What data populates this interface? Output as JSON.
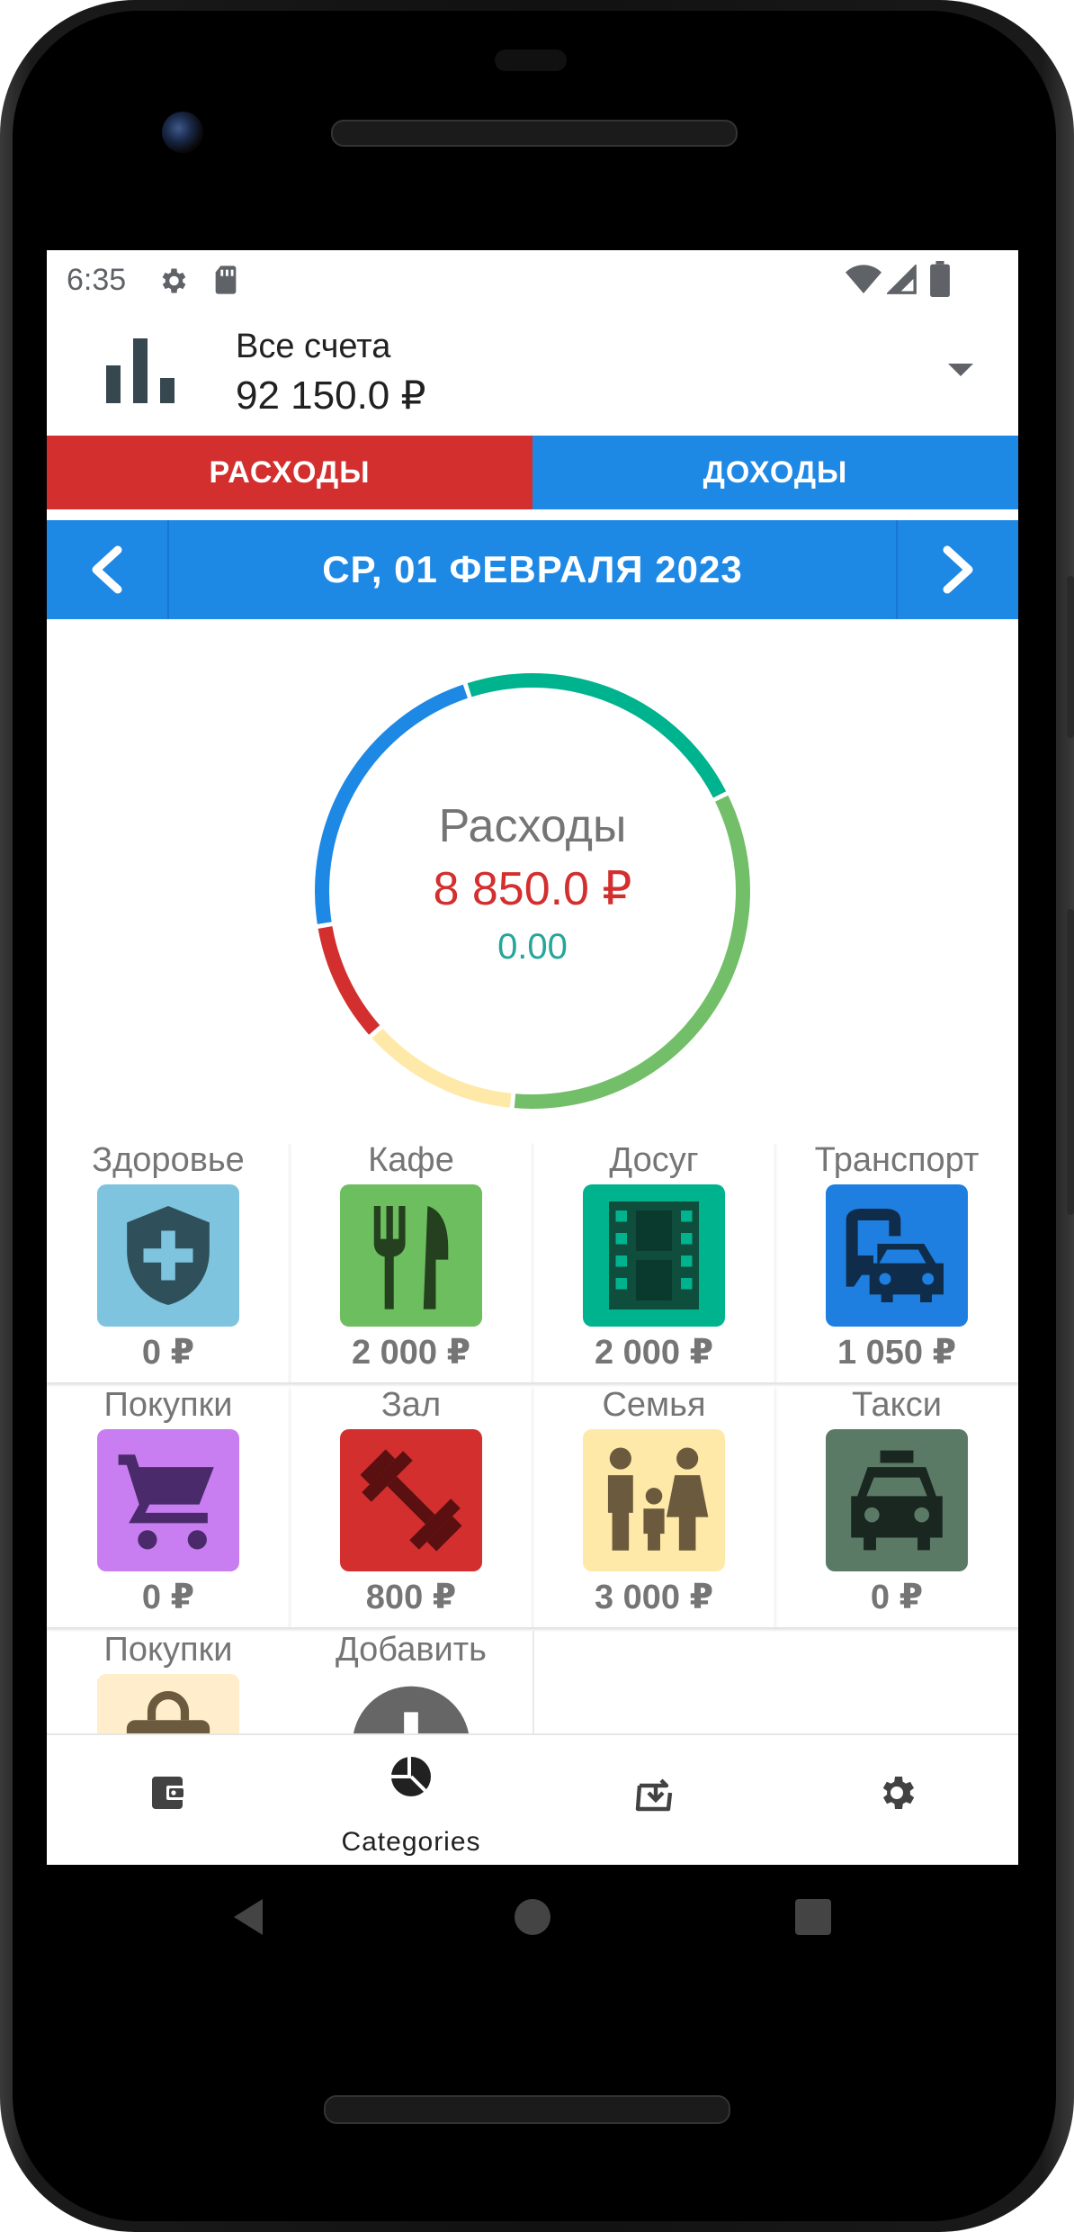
{
  "status_bar": {
    "time": "6:35"
  },
  "account": {
    "name": "Все счета",
    "balance": "92 150.0 ₽"
  },
  "tabs": {
    "expense": "РАСХОДЫ",
    "income": "ДОХОДЫ"
  },
  "date_nav": {
    "date": "СР, 01 ФЕВРАЛЯ 2023"
  },
  "summary": {
    "title": "Расходы",
    "amount": "8 850.0 ₽",
    "sub": "0.00"
  },
  "donut_segments": [
    {
      "category": "Досуг",
      "value": 2000,
      "color": "#00b38f"
    },
    {
      "category": "Семья",
      "value": 3000,
      "color": "#73bf69"
    },
    {
      "category": "Транспорт",
      "value": 1050,
      "color": "#ffe9a8"
    },
    {
      "category": "Зал",
      "value": 800,
      "color": "#d32f2f"
    },
    {
      "category": "Кафе",
      "value": 2000,
      "color": "#1e88e5"
    }
  ],
  "categories": [
    {
      "name": "Здоровье",
      "amount": "0 ₽",
      "icon": "shield-plus-icon",
      "color": "#7fc4de"
    },
    {
      "name": "Кафе",
      "amount": "2 000 ₽",
      "icon": "fork-knife-icon",
      "color": "#6dbe5e"
    },
    {
      "name": "Досуг",
      "amount": "2 000 ₽",
      "icon": "film-strip-icon",
      "color": "#00b38f"
    },
    {
      "name": "Транспорт",
      "amount": "1 050 ₽",
      "icon": "bus-car-icon",
      "color": "#1e7fe0"
    },
    {
      "name": "Покупки",
      "amount": "0 ₽",
      "icon": "shopping-cart-icon",
      "color": "#c87ef0"
    },
    {
      "name": "Зал",
      "amount": "800 ₽",
      "icon": "dumbbell-icon",
      "color": "#d32f2f"
    },
    {
      "name": "Семья",
      "amount": "3 000 ₽",
      "icon": "family-icon",
      "color": "#ffe9a8"
    },
    {
      "name": "Такси",
      "amount": "0 ₽",
      "icon": "taxi-icon",
      "color": "#5a7a66"
    },
    {
      "name": "Покупки",
      "amount": "",
      "icon": "shopping-bag-icon",
      "color": "#ffedcc"
    },
    {
      "name": "Добавить",
      "amount": "",
      "icon": "add-circle-icon",
      "color": "#666666"
    }
  ],
  "bottom_nav": {
    "items": [
      {
        "id": "accounts",
        "icon": "wallet-icon",
        "label": ""
      },
      {
        "id": "categories",
        "icon": "pie-chart-icon",
        "label": "Categories"
      },
      {
        "id": "transactions",
        "icon": "transfer-icon",
        "label": ""
      },
      {
        "id": "settings",
        "icon": "gear-icon",
        "label": ""
      }
    ]
  }
}
